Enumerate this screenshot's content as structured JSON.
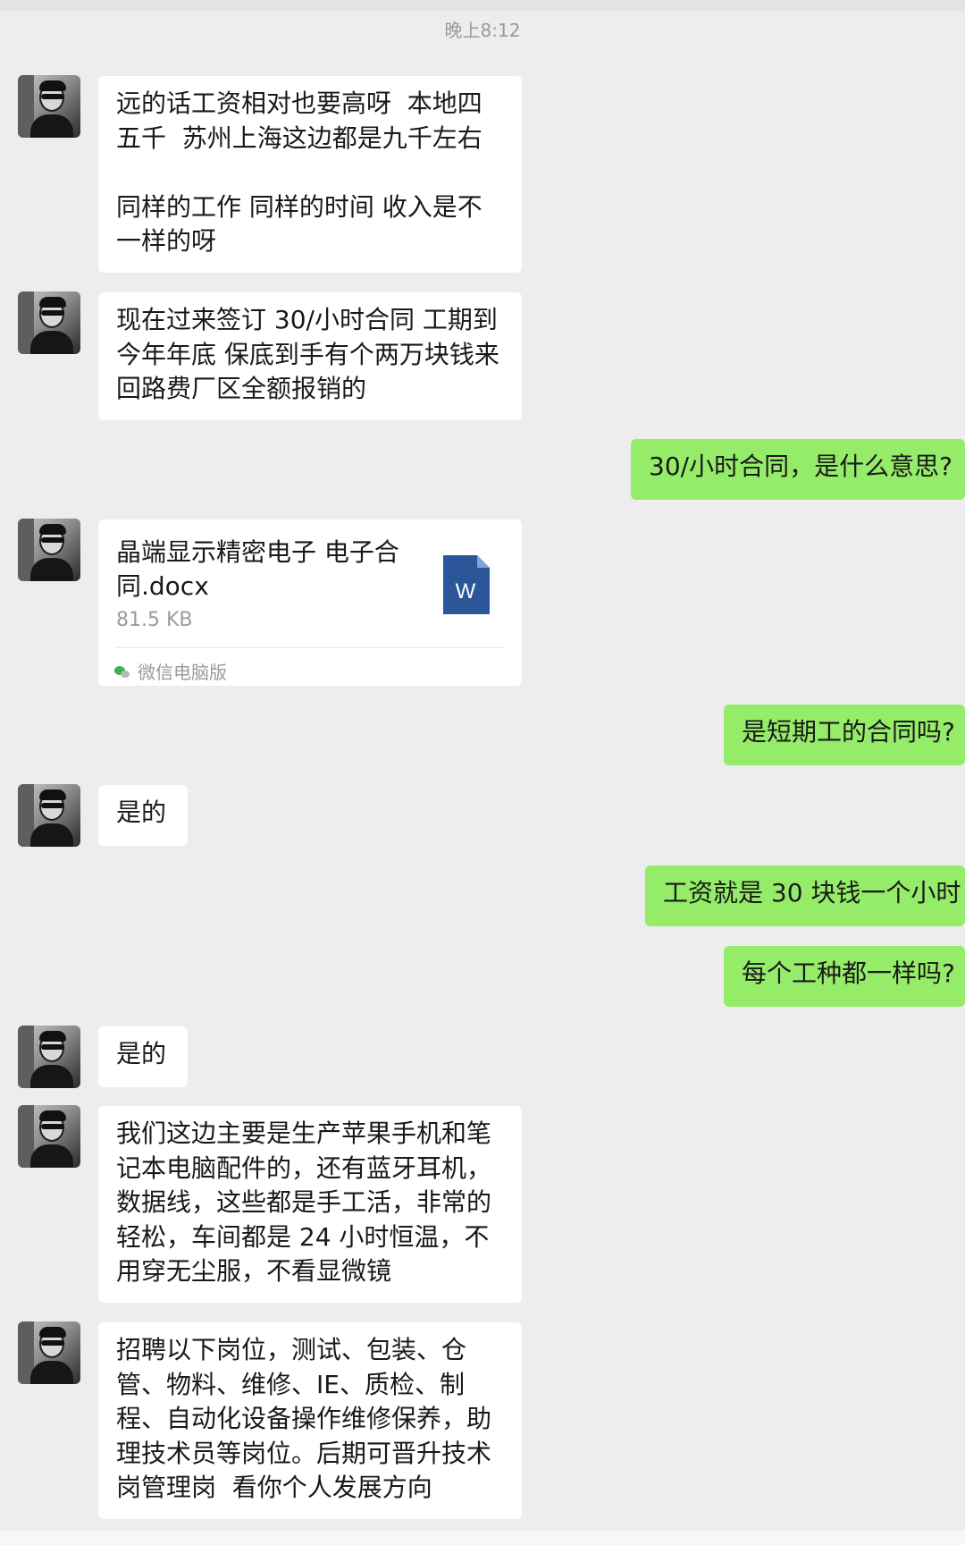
{
  "chat": {
    "timestamp": "晚上8:12",
    "messages": [
      {
        "id": "m1",
        "sender": "contact",
        "type": "text",
        "text": "远的话工资相对也要高呀  本地四五千  苏州上海这边都是九千左右\n\n同样的工作 同样的时间 收入是不一样的呀"
      },
      {
        "id": "m2",
        "sender": "contact",
        "type": "text",
        "text": "现在过来签订 30/小时合同 工期到今年年底 保底到手有个两万块钱来回路费厂区全额报销的"
      },
      {
        "id": "m3",
        "sender": "self",
        "type": "text",
        "text": "30/小时合同，是什么意思?"
      },
      {
        "id": "m4",
        "sender": "contact",
        "type": "file",
        "file_name": "晶端显示精密电子 电子合同.docx",
        "file_size": "81.5 KB",
        "file_icon": "word-doc-icon",
        "file_icon_letter": "W",
        "source": "微信电脑版"
      },
      {
        "id": "m5",
        "sender": "self",
        "type": "text",
        "text": "是短期工的合同吗?"
      },
      {
        "id": "m6",
        "sender": "contact",
        "type": "text",
        "text": "是的"
      },
      {
        "id": "m7",
        "sender": "self",
        "type": "text",
        "text": "工资就是 30 块钱一个小时"
      },
      {
        "id": "m8",
        "sender": "self",
        "type": "text",
        "text": "每个工种都一样吗?"
      },
      {
        "id": "m9",
        "sender": "contact",
        "type": "text",
        "text": "是的"
      },
      {
        "id": "m10",
        "sender": "contact",
        "type": "text",
        "text": "我们这边主要是生产苹果手机和笔记本电脑配件的，还有蓝牙耳机，数据线，这些都是手工活，非常的轻松，车间都是 24 小时恒温，不用穿无尘服，不看显微镜"
      },
      {
        "id": "m11",
        "sender": "contact",
        "type": "text",
        "text": "招聘以下岗位，测试、包装、仓管、物料、维修、IE、质检、制程、自动化设备操作维修保养，助理技术员等岗位。后期可晋升技术岗管理岗  看你个人发展方向"
      }
    ]
  },
  "colors": {
    "background": "#ededed",
    "incoming_bubble": "#ffffff",
    "outgoing_bubble": "#95ec69",
    "word_icon": "#2b579a"
  }
}
